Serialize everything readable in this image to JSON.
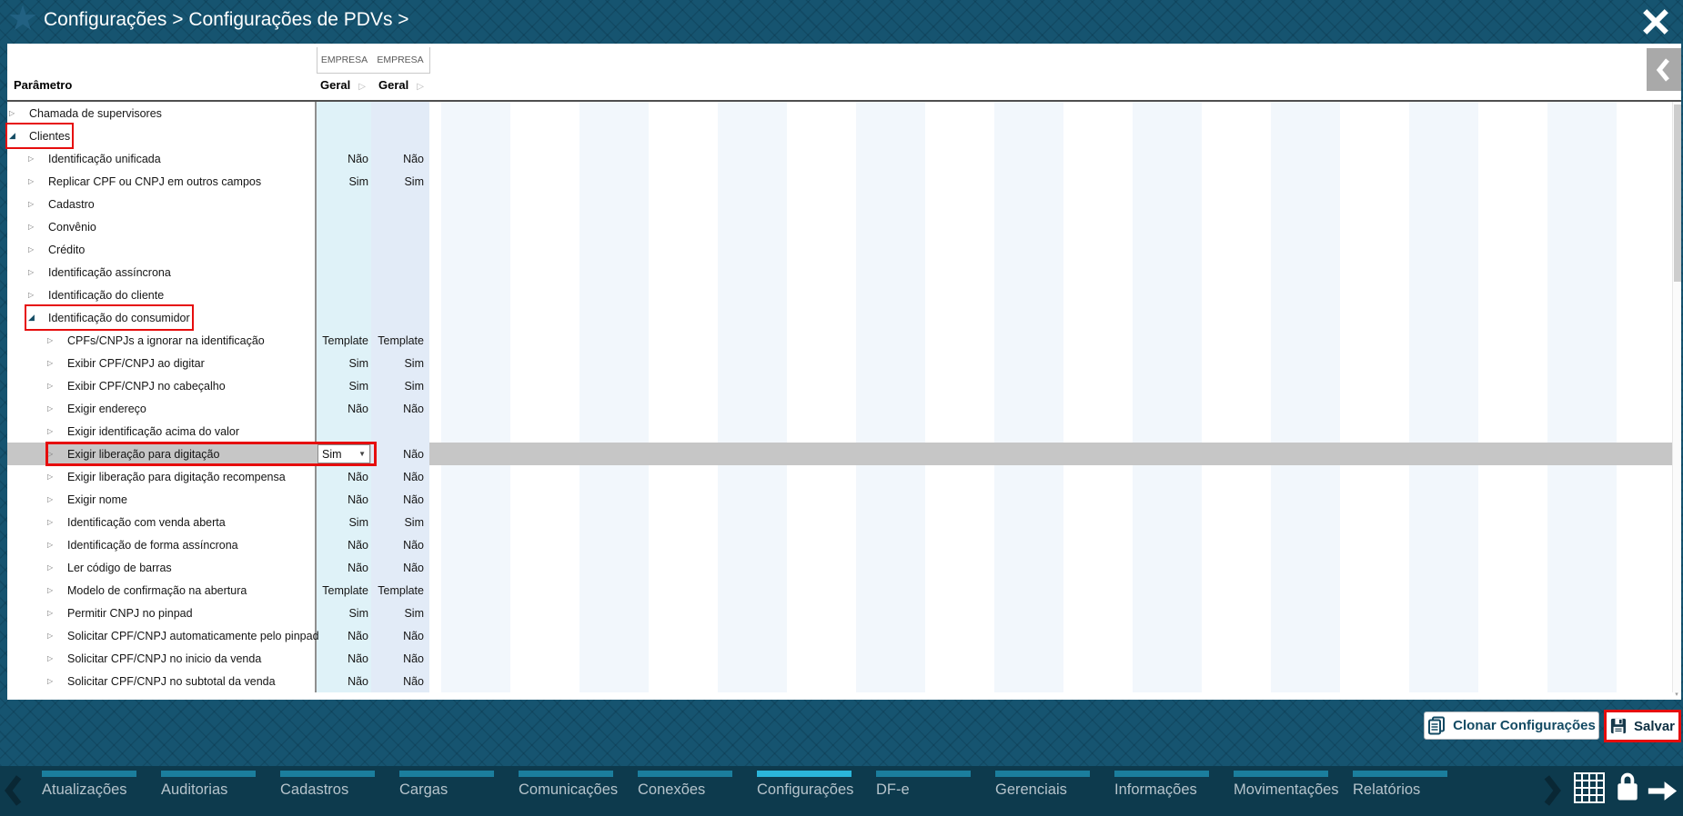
{
  "header": {
    "breadcrumb": [
      "Configurações",
      "Configurações de PDVs"
    ],
    "separator": ">"
  },
  "table": {
    "group_headers": [
      "EMPRESA",
      "EMPRESA"
    ],
    "param_header": "Parâmetro",
    "column_headers": [
      "Geral",
      "Geral"
    ],
    "sort_glyph": "▷",
    "rows": [
      {
        "label": "Chamada de supervisores",
        "level": 0,
        "expanded": false,
        "values": [
          "",
          ""
        ]
      },
      {
        "label": "Clientes",
        "level": 0,
        "expanded": true,
        "values": [
          "",
          ""
        ],
        "annotated": true
      },
      {
        "label": "Identificação unificada",
        "level": 1,
        "expanded": false,
        "values": [
          "Não",
          "Não"
        ]
      },
      {
        "label": "Replicar CPF ou CNPJ em outros campos",
        "level": 1,
        "expanded": false,
        "values": [
          "Sim",
          "Sim"
        ]
      },
      {
        "label": "Cadastro",
        "level": 1,
        "expanded": false,
        "values": [
          "",
          ""
        ]
      },
      {
        "label": "Convênio",
        "level": 1,
        "expanded": false,
        "values": [
          "",
          ""
        ]
      },
      {
        "label": "Crédito",
        "level": 1,
        "expanded": false,
        "values": [
          "",
          ""
        ]
      },
      {
        "label": "Identificação assíncrona",
        "level": 1,
        "expanded": false,
        "values": [
          "",
          ""
        ]
      },
      {
        "label": "Identificação do cliente",
        "level": 1,
        "expanded": false,
        "values": [
          "",
          ""
        ]
      },
      {
        "label": "Identificação do consumidor",
        "level": 1,
        "expanded": true,
        "values": [
          "",
          ""
        ],
        "annotated": true
      },
      {
        "label": "CPFs/CNPJs a ignorar na identificação",
        "level": 2,
        "expanded": false,
        "values": [
          "Template",
          "Template"
        ]
      },
      {
        "label": "Exibir CPF/CNPJ ao digitar",
        "level": 2,
        "expanded": false,
        "values": [
          "Sim",
          "Sim"
        ]
      },
      {
        "label": "Exibir CPF/CNPJ no cabeçalho",
        "level": 2,
        "expanded": false,
        "values": [
          "Sim",
          "Sim"
        ]
      },
      {
        "label": "Exigir endereço",
        "level": 2,
        "expanded": false,
        "values": [
          "Não",
          "Não"
        ]
      },
      {
        "label": "Exigir identificação acima do valor",
        "level": 2,
        "expanded": false,
        "values": [
          "",
          ""
        ]
      },
      {
        "label": "Exigir liberação para digitação",
        "level": 2,
        "expanded": false,
        "values": [
          "Sim",
          "Não"
        ],
        "selected": true,
        "annotated": true,
        "dropdown": true
      },
      {
        "label": "Exigir liberação para digitação recompensa",
        "level": 2,
        "expanded": false,
        "values": [
          "Não",
          "Não"
        ]
      },
      {
        "label": "Exigir nome",
        "level": 2,
        "expanded": false,
        "values": [
          "Não",
          "Não"
        ]
      },
      {
        "label": "Identificação com venda aberta",
        "level": 2,
        "expanded": false,
        "values": [
          "Sim",
          "Sim"
        ]
      },
      {
        "label": "Identificação de forma assíncrona",
        "level": 2,
        "expanded": false,
        "values": [
          "Não",
          "Não"
        ]
      },
      {
        "label": "Ler código de barras",
        "level": 2,
        "expanded": false,
        "values": [
          "Não",
          "Não"
        ]
      },
      {
        "label": "Modelo de confirmação na abertura",
        "level": 2,
        "expanded": false,
        "values": [
          "Template",
          "Template"
        ]
      },
      {
        "label": "Permitir CNPJ no pinpad",
        "level": 2,
        "expanded": false,
        "values": [
          "Sim",
          "Sim"
        ]
      },
      {
        "label": "Solicitar CPF/CNPJ automaticamente pelo pinpad",
        "level": 2,
        "expanded": false,
        "values": [
          "Não",
          "Não"
        ]
      },
      {
        "label": "Solicitar CPF/CNPJ no inicio da venda",
        "level": 2,
        "expanded": false,
        "values": [
          "Não",
          "Não"
        ]
      },
      {
        "label": "Solicitar CPF/CNPJ no subtotal da venda",
        "level": 2,
        "expanded": false,
        "values": [
          "Não",
          "Não"
        ]
      }
    ],
    "dropdown_value": "Sim"
  },
  "footer": {
    "clone_label": "Clonar Configurações",
    "save_label": "Salvar"
  },
  "nav": {
    "items": [
      {
        "label": "Atualizações",
        "active": false
      },
      {
        "label": "Auditorias",
        "active": false
      },
      {
        "label": "Cadastros",
        "active": false
      },
      {
        "label": "Cargas",
        "active": false
      },
      {
        "label": "Comunicações",
        "active": false
      },
      {
        "label": "Conexões",
        "active": false
      },
      {
        "label": "Configurações",
        "active": true
      },
      {
        "label": "DF-e",
        "active": false
      },
      {
        "label": "Gerenciais",
        "active": false
      },
      {
        "label": "Informações",
        "active": false
      },
      {
        "label": "Movimentações",
        "active": false
      },
      {
        "label": "Relatórios",
        "active": false
      }
    ]
  },
  "colors": {
    "topbar": "#165470",
    "navbar": "#0d3a4d",
    "accent_active_tab": "#2bb5da",
    "accent_inactive_tab": "#1b7e9d",
    "annotation_red": "#e60d0d",
    "selected_row": "#c6c6c6",
    "column1_bg": "#dff2f8",
    "column2_bg": "#e2ebf7"
  }
}
